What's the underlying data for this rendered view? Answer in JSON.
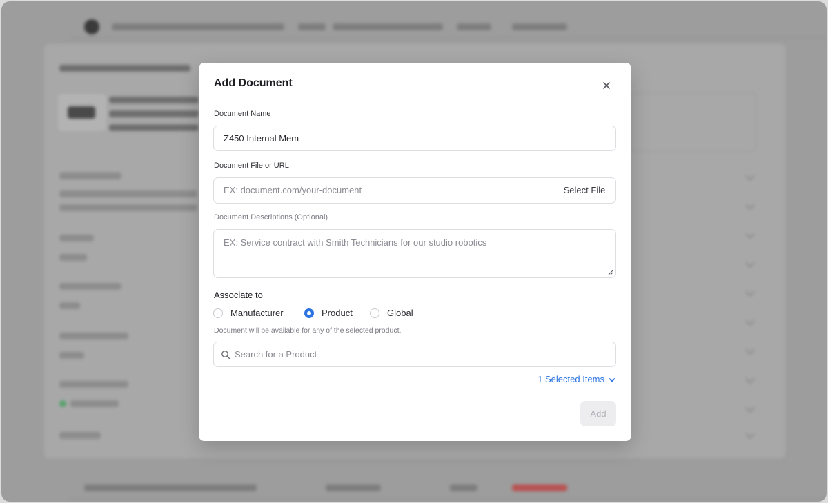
{
  "modal": {
    "title": "Add Document",
    "document_name_label": "Document Name",
    "document_name_value": "Z450 Internal Mem",
    "document_file_label": "Document File or URL",
    "document_file_placeholder": "EX: document.com/your-document",
    "select_file_label": "Select File",
    "description_label": "Document Descriptions (Optional)",
    "description_placeholder": "EX: Service contract with Smith Technicians for our studio robotics",
    "associate_title": "Associate to",
    "associate_options": [
      {
        "label": "Manufacturer",
        "selected": false
      },
      {
        "label": "Product",
        "selected": true
      },
      {
        "label": "Global",
        "selected": false
      }
    ],
    "hint": "Document will be available for any of the selected product.",
    "search_placeholder": "Search for a Product",
    "selected_items_label": "1 Selected Items",
    "add_label": "Add"
  },
  "colors": {
    "accent": "#2c74e0",
    "overlay": "#9d9d9d",
    "disabled_button_bg": "#ededf0"
  },
  "icons": {
    "close": "close-icon",
    "search": "search-icon",
    "chevron": "chevron-down-icon"
  }
}
